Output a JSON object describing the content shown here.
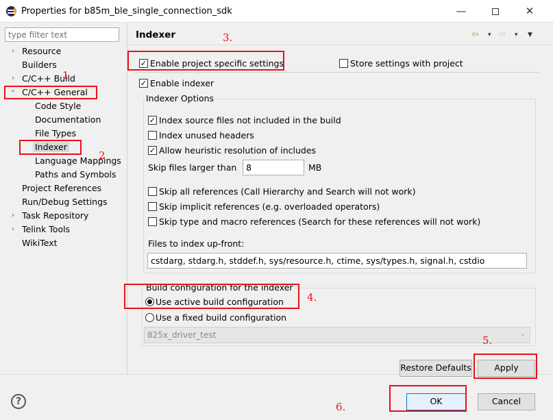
{
  "window": {
    "title": "Properties for b85m_ble_single_connection_sdk",
    "min": "—",
    "close": "✕"
  },
  "filter": {
    "placeholder": "type filter text"
  },
  "tree": {
    "items": [
      {
        "label": "Resource",
        "caret": "›"
      },
      {
        "label": "Builders",
        "caret": ""
      },
      {
        "label": "C/C++ Build",
        "caret": "›"
      },
      {
        "label": "C/C++ General",
        "caret": "⌄"
      },
      {
        "label": "Code Style",
        "caret": ""
      },
      {
        "label": "Documentation",
        "caret": ""
      },
      {
        "label": "File Types",
        "caret": ""
      },
      {
        "label": "Indexer",
        "caret": ""
      },
      {
        "label": "Language Mappings",
        "caret": ""
      },
      {
        "label": "Paths and Symbols",
        "caret": ""
      },
      {
        "label": "Project References",
        "caret": ""
      },
      {
        "label": "Run/Debug Settings",
        "caret": ""
      },
      {
        "label": "Task Repository",
        "caret": "›"
      },
      {
        "label": "Telink Tools",
        "caret": "›"
      },
      {
        "label": "WikiText",
        "caret": ""
      }
    ]
  },
  "pane": {
    "title": "Indexer",
    "nav_back": "⇦",
    "nav_fwd": "⇨",
    "dropdown": "▾",
    "menu": "▼",
    "enable_project": "Enable project specific settings",
    "store_settings": "Store settings with project",
    "enable_indexer": "Enable indexer",
    "indexer_options": {
      "title": "Indexer Options",
      "index_source": "Index source files not included in the build",
      "index_unused": "Index unused headers",
      "heuristic": "Allow heuristic resolution of includes",
      "skip_larger_label": "Skip files larger than",
      "skip_larger_value": "8",
      "skip_larger_unit": "MB",
      "skip_all": "Skip all references (Call Hierarchy and Search will not work)",
      "skip_implicit": "Skip implicit references (e.g. overloaded operators)",
      "skip_type": "Skip type and macro references (Search for these references will not work)",
      "upfront_label": "Files to index up-front:",
      "upfront_value": "cstdarg, stdarg.h, stddef.h, sys/resource.h, ctime, sys/types.h, signal.h, cstdio"
    },
    "build_config": {
      "title": "Build configuration for the indexer",
      "use_active": "Use active build configuration",
      "use_fixed": "Use a fixed build configuration",
      "fixed_value": "825x_driver_test",
      "arrow": "⌄"
    },
    "restore_defaults": "Restore Defaults",
    "apply": "Apply"
  },
  "footer": {
    "help": "?",
    "ok": "OK",
    "cancel": "Cancel"
  },
  "checks": {
    "mark": "✓"
  },
  "annotations": {
    "a1": "1",
    "a2": "2",
    "a3": "3.",
    "a4": "4.",
    "a5": "5.",
    "a6": "6."
  }
}
